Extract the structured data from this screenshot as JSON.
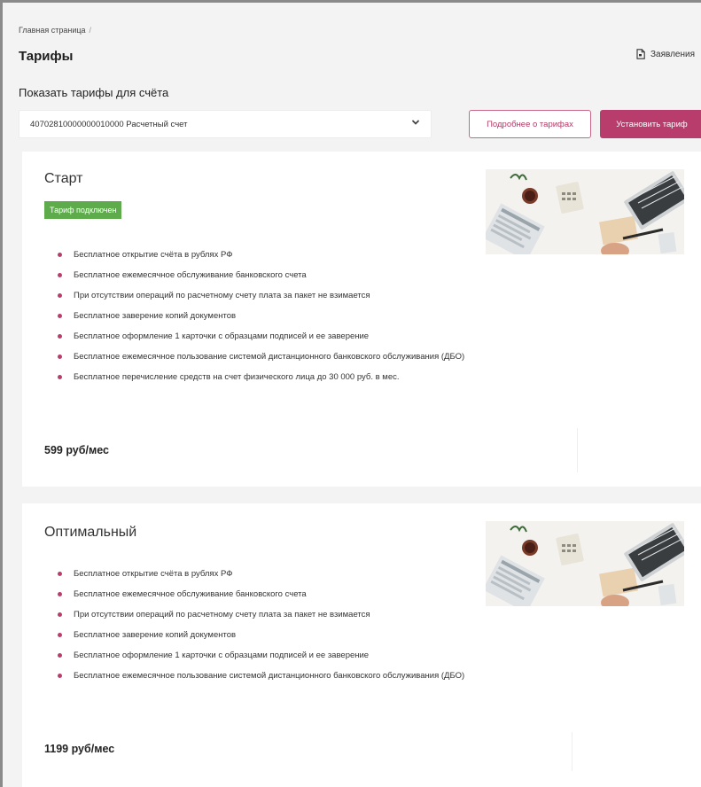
{
  "breadcrumb": {
    "home": "Главная страница",
    "separator": "/"
  },
  "page_title": "Тарифы",
  "applications_link": {
    "label": "Заявления",
    "icon": "document-icon"
  },
  "show_tariffs_label": "Показать тарифы для счёта",
  "account_select": {
    "value": "40702810000000010000 Расчетный счет",
    "icon": "chevron-down-icon"
  },
  "buttons": {
    "more_about_tariffs": "Подробнее о тарифах",
    "install_tariff": "Установить тариф"
  },
  "colors": {
    "accent": "#b83d6c",
    "badge_green": "#5dab4b",
    "background": "#f3f3f4"
  },
  "tariffs": [
    {
      "name": "Старт",
      "status_badge": "Тариф подключен",
      "features": [
        "Бесплатное открытие счёта в рублях РФ",
        "Бесплатное ежемесячное обслуживание банковского счета",
        "При отсутствии операций по расчетному счету плата за пакет не взимается",
        "Бесплатное заверение копий документов",
        "Бесплатное оформление 1 карточки с образцами подписей и ее заверение",
        "Бесплатное ежемесячное пользование системой дистанционного банковского обслуживания (ДБО)",
        "Бесплатное перечисление средств на счет физического лица до 30 000 руб. в мес."
      ],
      "price": "599 руб/мес"
    },
    {
      "name": "Оптимальный",
      "features": [
        "Бесплатное открытие счёта в рублях РФ",
        "Бесплатное ежемесячное обслуживание банковского счета",
        "При отсутствии операций по расчетному счету плата за пакет не взимается",
        "Бесплатное заверение копий документов",
        "Бесплатное оформление 1 карточки с образцами подписей и ее заверение",
        "Бесплатное ежемесячное пользование системой дистанционного банковского обслуживания (ДБО)"
      ],
      "price": "1199 руб/мес"
    }
  ]
}
